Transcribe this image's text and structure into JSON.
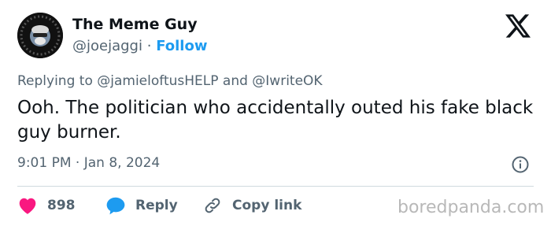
{
  "author": {
    "name": "The Meme Guy",
    "handle": "@joejaggi",
    "separator": "·",
    "follow_label": "Follow"
  },
  "reply_context": {
    "prefix": "Replying to",
    "mention1": "@jamieloftusHELP",
    "conjunction": "and",
    "mention2": "@IwriteOK"
  },
  "tweet": {
    "text": "Ooh. The politician who accidentally outed his fake black guy burner."
  },
  "meta": {
    "timestamp": "9:01 PM · Jan 8, 2024"
  },
  "actions": {
    "like_count": "898",
    "reply_label": "Reply",
    "copy_link_label": "Copy link"
  },
  "watermark": "boredpanda.com",
  "colors": {
    "accent": "#1d9bf0",
    "like": "#f91880",
    "muted": "#536471",
    "text": "#0f1419"
  }
}
